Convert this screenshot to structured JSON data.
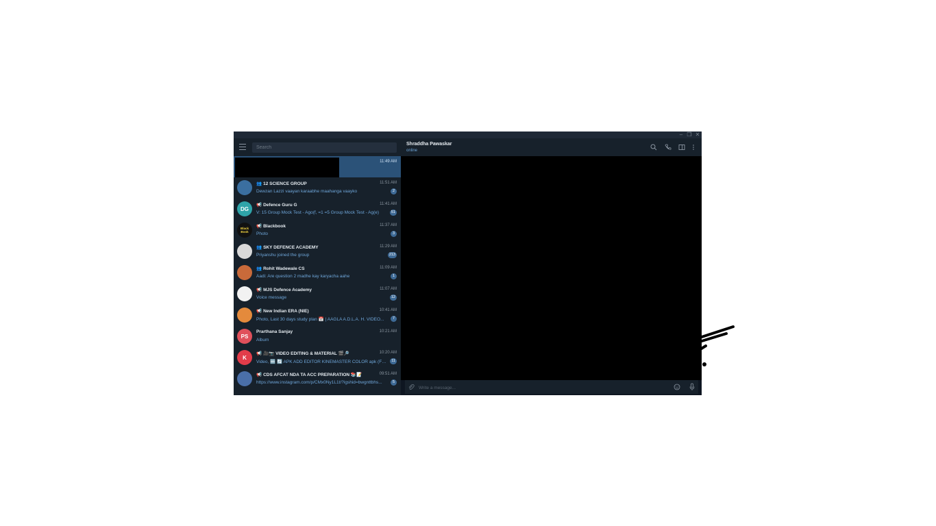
{
  "window": {
    "controls": [
      "–",
      "❐",
      "✕"
    ]
  },
  "search": {
    "placeholder": "Search"
  },
  "chats": [
    {
      "name": "",
      "kind": "",
      "preview": "",
      "time": "11:49 AM",
      "badge": "",
      "avatar_text": "",
      "avatar_color": "",
      "active": true
    },
    {
      "name": "12 SCIENCE GROUP",
      "kind": "group",
      "preview": "Dewzan Lazzi vaayan karaabhe maahanga vaayko",
      "time": "11:51 AM",
      "badge": "2",
      "avatar_text": "",
      "avatar_color": "#3b6fa0",
      "active": false
    },
    {
      "name": "Defence Guru G",
      "kind": "channel",
      "preview": "V: 15 Group Mock Test - Ago(f, =1 =5 Group Mock Test - Ag(e)",
      "time": "11:41 AM",
      "badge": "51",
      "avatar_text": "DG",
      "avatar_color": "#2fa4a9",
      "active": false
    },
    {
      "name": "Blackbook",
      "kind": "channel",
      "preview": "Photo",
      "time": "11:37 AM",
      "badge": "3",
      "avatar_text": "Black Book",
      "avatar_color": "#111111",
      "active": false
    },
    {
      "name": "SKY DEFENCE ACADEMY",
      "kind": "group",
      "preview": "Priyanshu joined the group",
      "time": "11:29 AM",
      "badge": "213",
      "avatar_text": "",
      "avatar_color": "#d9d9d9",
      "active": false
    },
    {
      "name": "Rohit Wadewale CS",
      "kind": "group",
      "preview": "Aadi: Are question 2 madhe kay karyacha aahe",
      "time": "11:09 AM",
      "badge": "1",
      "avatar_text": "",
      "avatar_color": "#c96a3a",
      "active": false
    },
    {
      "name": "MJS Defence Academy",
      "kind": "channel",
      "preview": "Voice message",
      "time": "11:07 AM",
      "badge": "12",
      "avatar_text": "",
      "avatar_color": "#f2f2f2",
      "active": false
    },
    {
      "name": "New Indian ERA (NIE)",
      "kind": "channel",
      "preview": "Photo, Last 30 days study plan 📅 | AAGLA A.D.L.A. H. VIDEO...",
      "time": "10:41 AM",
      "badge": "7",
      "avatar_text": "",
      "avatar_color": "#e48a3c",
      "active": false
    },
    {
      "name": "Prarthana Sanjay",
      "kind": "",
      "preview": "Album",
      "time": "10:21 AM",
      "badge": "",
      "avatar_text": "PS",
      "avatar_color": "#e0505b",
      "active": false
    },
    {
      "name": "🎥📷 VIDEO EDITING & MATERIAL 🎬🔎",
      "kind": "channel",
      "preview": "Video, 🆕 🔄 APK ADD EDITOR KINEMASTER COLOR apk (Fea...",
      "time": "10:20 AM",
      "badge": "11",
      "avatar_text": "K",
      "avatar_color": "#e23c4a",
      "active": false
    },
    {
      "name": "CDS AFCAT NDA TA ACC PREPARATION 📚📝",
      "kind": "channel",
      "preview": "https://www.instagram.com/p/CMx0Ny1L1t/?igshid=bwgnttbhs...",
      "time": "09:51 AM",
      "badge": "5",
      "avatar_text": "",
      "avatar_color": "#4a6fa8",
      "active": false
    }
  ],
  "header": {
    "name": "Shraddha Pawaskar",
    "status": "online"
  },
  "composer": {
    "placeholder": "Write a message..."
  },
  "colors": {
    "sidebar": "#17212b",
    "active_chat": "#2b5278",
    "accent": "#6ea5d8",
    "badge": "#3e6a96"
  }
}
